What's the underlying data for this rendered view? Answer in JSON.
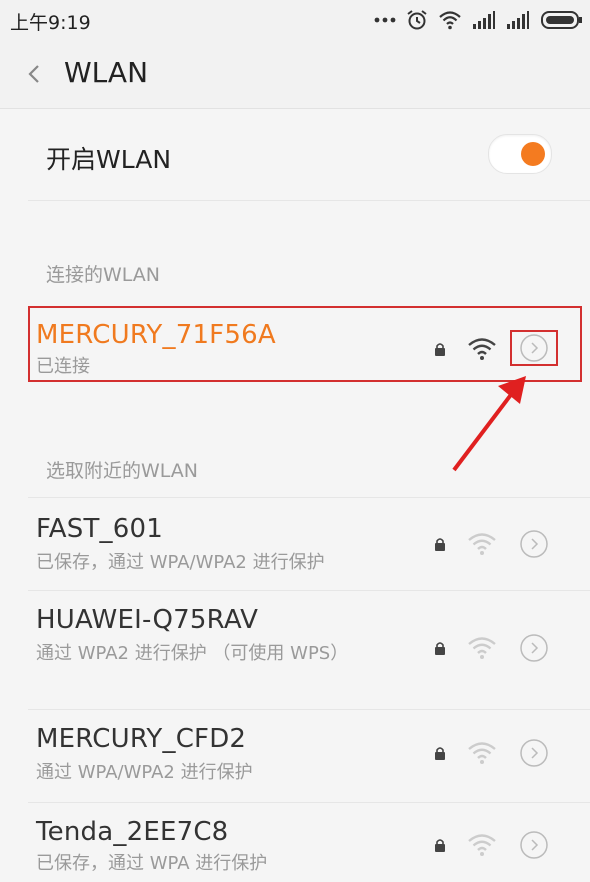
{
  "status": {
    "time": "上午9:19"
  },
  "header": {
    "title": "WLAN"
  },
  "wlan_toggle": {
    "label": "开启WLAN",
    "on": true,
    "accent": "#f47b20"
  },
  "connected_section": {
    "label": "连接的WLAN",
    "network": {
      "name": "MERCURY_71F56A",
      "status": "已连接"
    }
  },
  "nearby_section": {
    "label": "选取附近的WLAN",
    "networks": [
      {
        "name": "FAST_601",
        "detail": "已保存，通过 WPA/WPA2 进行保护"
      },
      {
        "name": "HUAWEI-Q75RAV",
        "detail": "通过 WPA2 进行保护 （可使用 WPS）"
      },
      {
        "name": "MERCURY_CFD2",
        "detail": "通过 WPA/WPA2 进行保护"
      },
      {
        "name": "Tenda_2EE7C8",
        "detail": "已保存，通过 WPA 进行保护"
      }
    ]
  },
  "colors": {
    "highlight": "#d32f2f",
    "active_text": "#f07a1f"
  },
  "icons": [
    "ellipsis-icon",
    "alarm-icon",
    "wifi-icon",
    "signal-icon",
    "battery-icon",
    "back-icon",
    "lock-icon",
    "chevron-right-icon",
    "annotation-arrow"
  ]
}
